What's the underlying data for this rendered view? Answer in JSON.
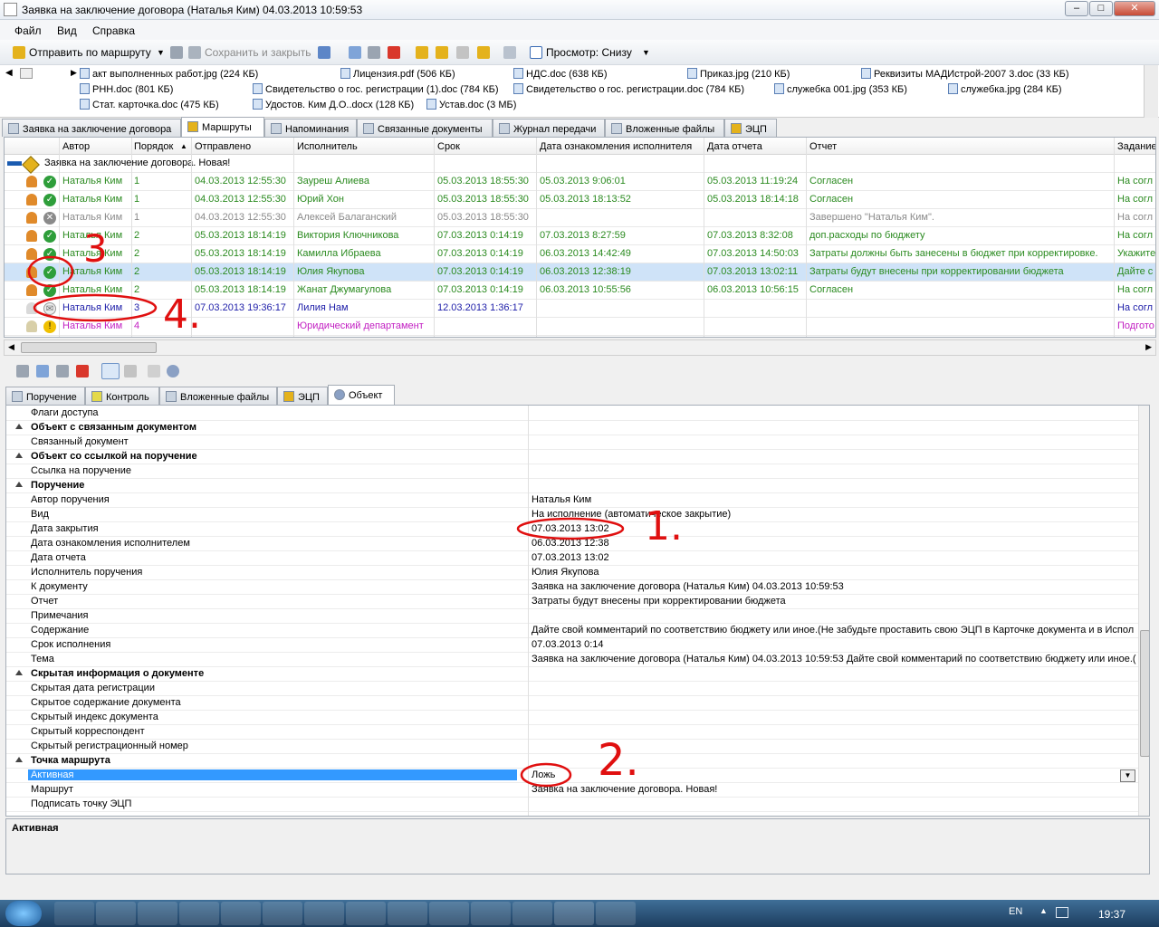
{
  "window": {
    "title": "Заявка на заключение договора (Наталья Ким) 04.03.2013 10:59:53",
    "min": "–",
    "max": "□",
    "close": "✕"
  },
  "menu": [
    "Файл",
    "Вид",
    "Справка"
  ],
  "toolbar": {
    "send_route": "Отправить по маршруту",
    "save_close": "Сохранить и закрыть",
    "view": "Просмотр: Снизу"
  },
  "attachments": [
    "акт выполненных работ.jpg (224 КБ)",
    "Лицензия.pdf (506 КБ)",
    "НДС.doc (638 КБ)",
    "Приказ.jpg (210 КБ)",
    "Реквизиты МАДИстрой-2007 3.doc (33 КБ)",
    "РНН.doc (801 КБ)",
    "Свидетельство о гос. регистрации (1).doc (784 КБ)",
    "Свидетельство о гос. регистрации.doc (784 КБ)",
    "служебка 001.jpg (353 КБ)",
    "служебка.jpg (284 КБ)",
    "Стат. карточка.doc (475 КБ)",
    "Удостов. Ким Д.О..docx (128 КБ)",
    "Устав.doc (3 МБ)"
  ],
  "main_tabs": [
    "Заявка на заключение договора",
    "Маршруты",
    "Напоминания",
    "Связанные документы",
    "Журнал передачи",
    "Вложенные файлы",
    "ЭЦП"
  ],
  "grid": {
    "columns": [
      "Автор",
      "Порядок",
      "Отправлено",
      "Исполнитель",
      "Срок",
      "Дата ознакомления исполнителя",
      "Дата отчета",
      "Отчет",
      "Задание"
    ],
    "group_title": "Заявка на заключение договора. Новая!",
    "rows": [
      {
        "author": "Наталья Ким",
        "order": "1",
        "sent": "04.03.2013 12:55:30",
        "executor": "Зауреш Алиева",
        "due": "05.03.2013 18:55:30",
        "ack": "05.03.2013 9:06:01",
        "report_date": "05.03.2013 11:19:24",
        "report": "Согласен",
        "task": "На согл",
        "color": "#2a8a1f",
        "status": "ok"
      },
      {
        "author": "Наталья Ким",
        "order": "1",
        "sent": "04.03.2013 12:55:30",
        "executor": "Юрий Хон",
        "due": "05.03.2013 18:55:30",
        "ack": "05.03.2013 18:13:52",
        "report_date": "05.03.2013 18:14:18",
        "report": "Согласен",
        "task": "На согл",
        "color": "#2a8a1f",
        "status": "ok"
      },
      {
        "author": "Наталья Ким",
        "order": "1",
        "sent": "04.03.2013 12:55:30",
        "executor": "Алексей Балаганский",
        "due": "05.03.2013 18:55:30",
        "ack": "",
        "report_date": "",
        "report": "Завершено \"Наталья Ким\".",
        "task": "На согл",
        "color": "#8a8a8a",
        "status": "x"
      },
      {
        "author": "Наталья Ким",
        "order": "2",
        "sent": "05.03.2013 18:14:19",
        "executor": "Виктория Ключникова",
        "due": "07.03.2013 0:14:19",
        "ack": "07.03.2013 8:27:59",
        "report_date": "07.03.2013 8:32:08",
        "report": "доп.расходы по бюджету",
        "task": "На согл",
        "color": "#2a8a1f",
        "status": "ok"
      },
      {
        "author": "Наталья Ким",
        "order": "2",
        "sent": "05.03.2013 18:14:19",
        "executor": "Камилла Ибраева",
        "due": "07.03.2013 0:14:19",
        "ack": "06.03.2013 14:42:49",
        "report_date": "07.03.2013 14:50:03",
        "report": "Затраты должны быть занесены в бюджет при корректировке.",
        "task": "Укажите",
        "color": "#2a8a1f",
        "status": "ok"
      },
      {
        "author": "Наталья Ким",
        "order": "2",
        "sent": "05.03.2013 18:14:19",
        "executor": "Юлия Якупова",
        "due": "07.03.2013 0:14:19",
        "ack": "06.03.2013 12:38:19",
        "report_date": "07.03.2013 13:02:11",
        "report": "Затраты будут внесены при корректировании бюджета",
        "task": "Дайте с",
        "color": "#2a8a1f",
        "status": "ok"
      },
      {
        "author": "Наталья Ким",
        "order": "2",
        "sent": "05.03.2013 18:14:19",
        "executor": "Жанат Джумагулова",
        "due": "07.03.2013 0:14:19",
        "ack": "06.03.2013 10:55:56",
        "report_date": "06.03.2013 10:56:15",
        "report": "Согласен",
        "task": "На согл",
        "color": "#2a8a1f",
        "status": "ok"
      },
      {
        "author": "Наталья Ким",
        "order": "3",
        "sent": "07.03.2013 19:36:17",
        "executor": "Лилия Нам",
        "due": "12.03.2013 1:36:17",
        "ack": "",
        "report_date": "",
        "report": "",
        "task": "На согл",
        "color": "#1c1ca8",
        "status": "mail"
      },
      {
        "author": "Наталья Ким",
        "order": "4",
        "sent": "",
        "executor": "Юридический департамент",
        "due": "",
        "ack": "",
        "report_date": "",
        "report": "",
        "task": "Подгото",
        "color": "#c21fc2",
        "status": "warn"
      }
    ]
  },
  "bottom_tabs": [
    "Поручение",
    "Контроль",
    "Вложенные файлы",
    "ЭЦП",
    "Объект"
  ],
  "properties": [
    {
      "name": "Флаги доступа",
      "value": ""
    },
    {
      "cat": true,
      "name": "Объект с связанным документом"
    },
    {
      "name": "Связанный документ",
      "value": ""
    },
    {
      "cat": true,
      "name": "Объект со ссылкой на поручение"
    },
    {
      "name": "Ссылка на поручение",
      "value": ""
    },
    {
      "cat": true,
      "name": "Поручение"
    },
    {
      "name": "Автор поручения",
      "value": "Наталья Ким"
    },
    {
      "name": "Вид",
      "value": "На исполнение (автоматическое закрытие)"
    },
    {
      "name": "Дата закрытия",
      "value": "07.03.2013 13:02"
    },
    {
      "name": "Дата ознакомления исполнителем",
      "value": "06.03.2013 12:38"
    },
    {
      "name": "Дата отчета",
      "value": "07.03.2013 13:02"
    },
    {
      "name": "Исполнитель поручения",
      "value": "Юлия Якупова"
    },
    {
      "name": "К документу",
      "value": "Заявка на заключение договора (Наталья Ким) 04.03.2013 10:59:53"
    },
    {
      "name": "Отчет",
      "value": "Затраты будут внесены при корректировании бюджета"
    },
    {
      "name": "Примечания",
      "value": ""
    },
    {
      "name": "Содержание",
      "value": "Дайте свой комментарий по соответствию бюджету или иное.(Не забудьте проставить свою ЭЦП в Карточке документа и в Испол"
    },
    {
      "name": "Срок исполнения",
      "value": "07.03.2013 0:14"
    },
    {
      "name": "Тема",
      "value": "Заявка на заключение договора (Наталья Ким) 04.03.2013 10:59:53 Дайте свой комментарий по соответствию бюджету или иное.("
    },
    {
      "cat": true,
      "name": "Скрытая информация о документе"
    },
    {
      "name": "Скрытая дата регистрации",
      "value": ""
    },
    {
      "name": "Скрытое содержание документа",
      "value": ""
    },
    {
      "name": "Скрытый индекс документа",
      "value": ""
    },
    {
      "name": "Скрытый корреспондент",
      "value": ""
    },
    {
      "name": "Скрытый регистрационный номер",
      "value": ""
    },
    {
      "cat": true,
      "name": "Точка маршрута"
    },
    {
      "name": "Активная",
      "value": "Ложь",
      "selected": true
    },
    {
      "name": "Маршрут",
      "value": "Заявка на заключение договора. Новая!"
    },
    {
      "name": "Подписать точку ЭЦП",
      "value": ""
    }
  ],
  "description_title": "Активная",
  "annotations": [
    "1.",
    "2.",
    "3",
    "4."
  ],
  "tray": {
    "lang": "EN",
    "time": "19:37"
  }
}
